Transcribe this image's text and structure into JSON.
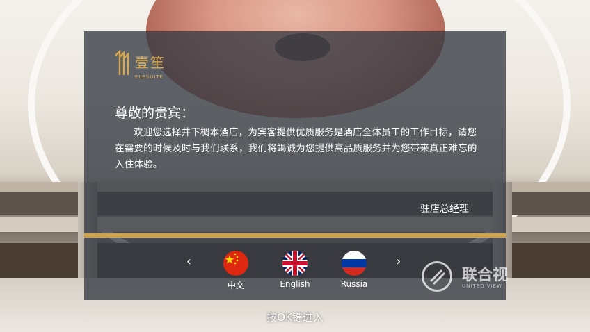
{
  "logo": {
    "chinese_name": "壹笙",
    "english_name": "ELESUITE",
    "icon": "hotel-logo-icon"
  },
  "welcome": {
    "greeting": "尊敬的贵宾：",
    "message": "欢迎您选择井下椆本酒店，为宾客提供优质服务是酒店全体员工的工作目标，请您在需要的时候及时与我们联系，我们将竭诚为您提供高品质服务并为您带来真正难忘的入住体验。",
    "signature": "驻店总经理"
  },
  "languages": {
    "prev_icon": "chevron-left-icon",
    "next_icon": "chevron-right-icon",
    "prev_glyph": "‹",
    "next_glyph": "›",
    "items": [
      {
        "label": "中文",
        "icon": "china-flag-icon"
      },
      {
        "label": "English",
        "icon": "uk-flag-icon"
      },
      {
        "label": "Russia",
        "icon": "russia-flag-icon"
      }
    ]
  },
  "hint": "按OK键进入",
  "watermark": {
    "text": "联合视",
    "subtext": "UNITED VIEW",
    "icon": "united-view-logo-icon"
  },
  "colors": {
    "accent_gold": "#caa24e",
    "panel_bg": "#343a42"
  }
}
